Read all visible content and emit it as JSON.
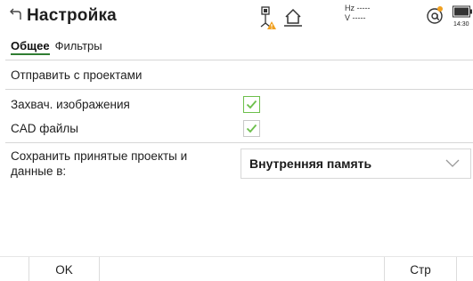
{
  "header": {
    "title": "Настройка",
    "hz_label": "Hz -----",
    "v_label": "V  -----",
    "time": "14:30",
    "icons": [
      "back-arrow-icon",
      "gnss-warning-icon",
      "home-icon",
      "at-connection-icon",
      "battery-icon"
    ]
  },
  "tabs": [
    {
      "label": "Общее",
      "active": true
    },
    {
      "label": "Фильтры",
      "active": false
    }
  ],
  "rows": {
    "send_with_projects": "Отправить с проектами",
    "capture_images": {
      "label": "Захвач. изображения",
      "checked": true
    },
    "cad_files": {
      "label": "CAD файлы",
      "checked": true
    },
    "save_location": {
      "label_line1": "Сохранить принятые проекты и",
      "label_line2": "данные в:",
      "value": "Внутренняя память"
    }
  },
  "footer": {
    "ok_label": "OK",
    "page_label": "Стр"
  },
  "colors": {
    "check_green": "#6cbf4b",
    "tab_underline": "#2f7d32",
    "warning_orange": "#f0a020"
  }
}
